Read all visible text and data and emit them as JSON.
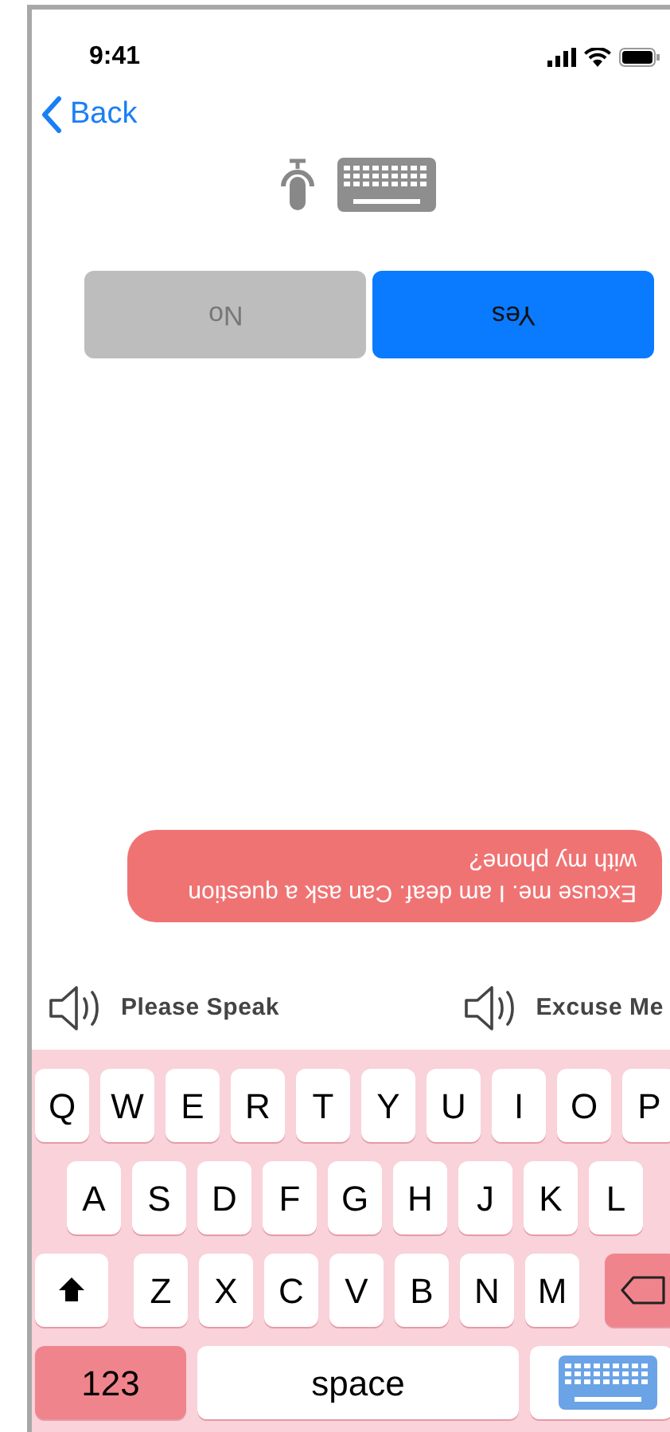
{
  "status_bar": {
    "time": "9:41"
  },
  "nav": {
    "back": "Back"
  },
  "answers": [
    {
      "label": "No",
      "selected": false,
      "upside_down": true
    },
    {
      "label": "Yes",
      "selected": true,
      "upside_down": true
    }
  ],
  "message": {
    "text": "Excuse me. I am deaf. Can  ask a question with my phone?",
    "upside_down": true
  },
  "phrases": [
    {
      "label": "Please Speak"
    },
    {
      "label": "Excuse Me"
    }
  ],
  "keyboard": {
    "rows": [
      [
        {
          "kind": "letter",
          "label": "Q"
        },
        {
          "kind": "letter",
          "label": "W"
        },
        {
          "kind": "letter",
          "label": "E"
        },
        {
          "kind": "letter",
          "label": "R"
        },
        {
          "kind": "letter",
          "label": "T"
        },
        {
          "kind": "letter",
          "label": "Y"
        },
        {
          "kind": "letter",
          "label": "U"
        },
        {
          "kind": "letter",
          "label": "I"
        },
        {
          "kind": "letter",
          "label": "O"
        },
        {
          "kind": "letter",
          "label": "P"
        }
      ],
      [
        {
          "kind": "letter",
          "label": "A"
        },
        {
          "kind": "letter",
          "label": "S"
        },
        {
          "kind": "letter",
          "label": "D"
        },
        {
          "kind": "letter",
          "label": "F"
        },
        {
          "kind": "letter",
          "label": "G"
        },
        {
          "kind": "letter",
          "label": "H"
        },
        {
          "kind": "letter",
          "label": "J"
        },
        {
          "kind": "letter",
          "label": "K"
        },
        {
          "kind": "letter",
          "label": "L"
        }
      ],
      [
        {
          "kind": "shift"
        },
        {
          "kind": "letter",
          "label": "Z"
        },
        {
          "kind": "letter",
          "label": "X"
        },
        {
          "kind": "letter",
          "label": "C"
        },
        {
          "kind": "letter",
          "label": "V"
        },
        {
          "kind": "letter",
          "label": "B"
        },
        {
          "kind": "letter",
          "label": "N"
        },
        {
          "kind": "letter",
          "label": "M"
        },
        {
          "kind": "delete"
        }
      ]
    ],
    "bottom_row": [
      {
        "kind": "numbers",
        "label": "123"
      },
      {
        "kind": "space",
        "label": "space"
      },
      {
        "kind": "keyboard"
      }
    ]
  }
}
